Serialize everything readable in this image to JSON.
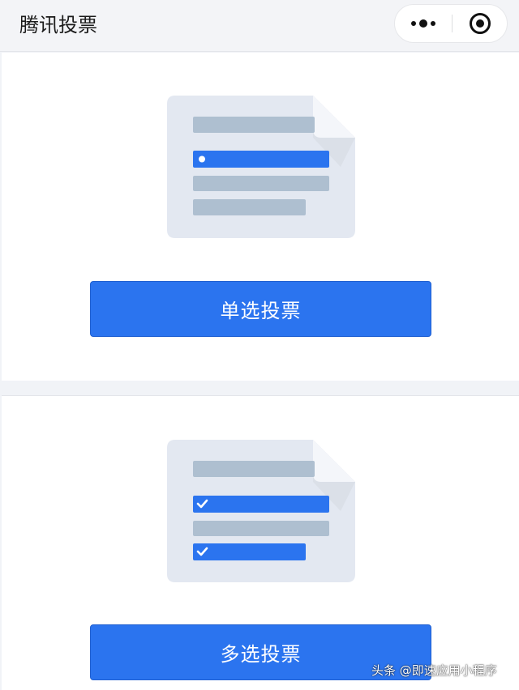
{
  "navbar": {
    "title": "腾讯投票",
    "capsule": {
      "more_icon": "more-dots-icon",
      "close_icon": "target-close-icon"
    }
  },
  "cards": [
    {
      "button_label": "单选投票",
      "illustration": "single-choice-ballot-icon"
    },
    {
      "button_label": "多选投票",
      "illustration": "multiple-choice-ballot-icon"
    }
  ],
  "watermark": "头条 @即速应用小程序",
  "colors": {
    "accent": "#2b74ef",
    "paper": "#e3e8f1",
    "placeholder_bar": "#aebfd0",
    "background": "#f1f3f7"
  }
}
